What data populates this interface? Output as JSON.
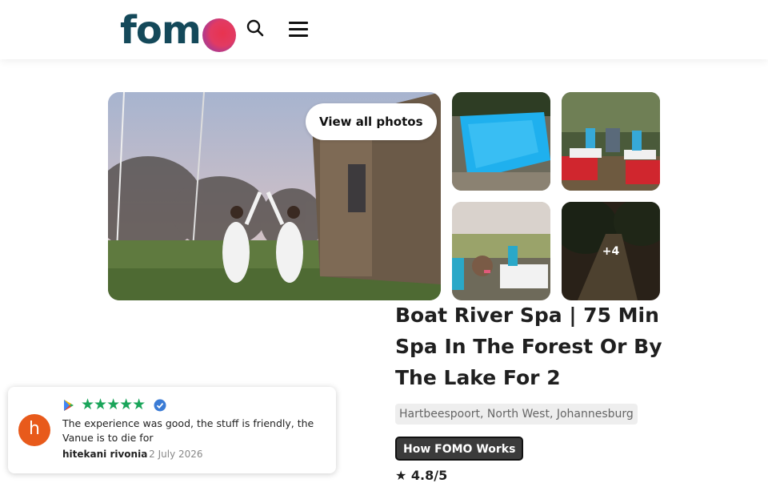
{
  "brand": {
    "logo_text": "fom"
  },
  "header": {
    "search_icon": "search-icon",
    "menu_icon": "hamburger-menu-icon"
  },
  "gallery": {
    "view_all_label": "View all photos",
    "extra_photos_label": "+4"
  },
  "product": {
    "title": "Boat River Spa | 75 Min Spa In The Forest Or By The Lake For 2",
    "location": "Hartbeespoort, North West, Johannesburg",
    "how_it_works_label": "How FOMO Works",
    "rating_text": "★ 4.8/5"
  },
  "review": {
    "avatar_letter": "h",
    "stars": "★★★★★",
    "rating_value": 5,
    "text": "The experience was good, the stuff is friendly, the Vanue is to die for",
    "author": "hitekani rivonia",
    "date": "- 2 July 2026"
  },
  "colors": {
    "logo": "#14495a",
    "star_green": "#1aa55a",
    "avatar_orange": "#e85a1b",
    "button_dark": "#3b3b3b"
  }
}
